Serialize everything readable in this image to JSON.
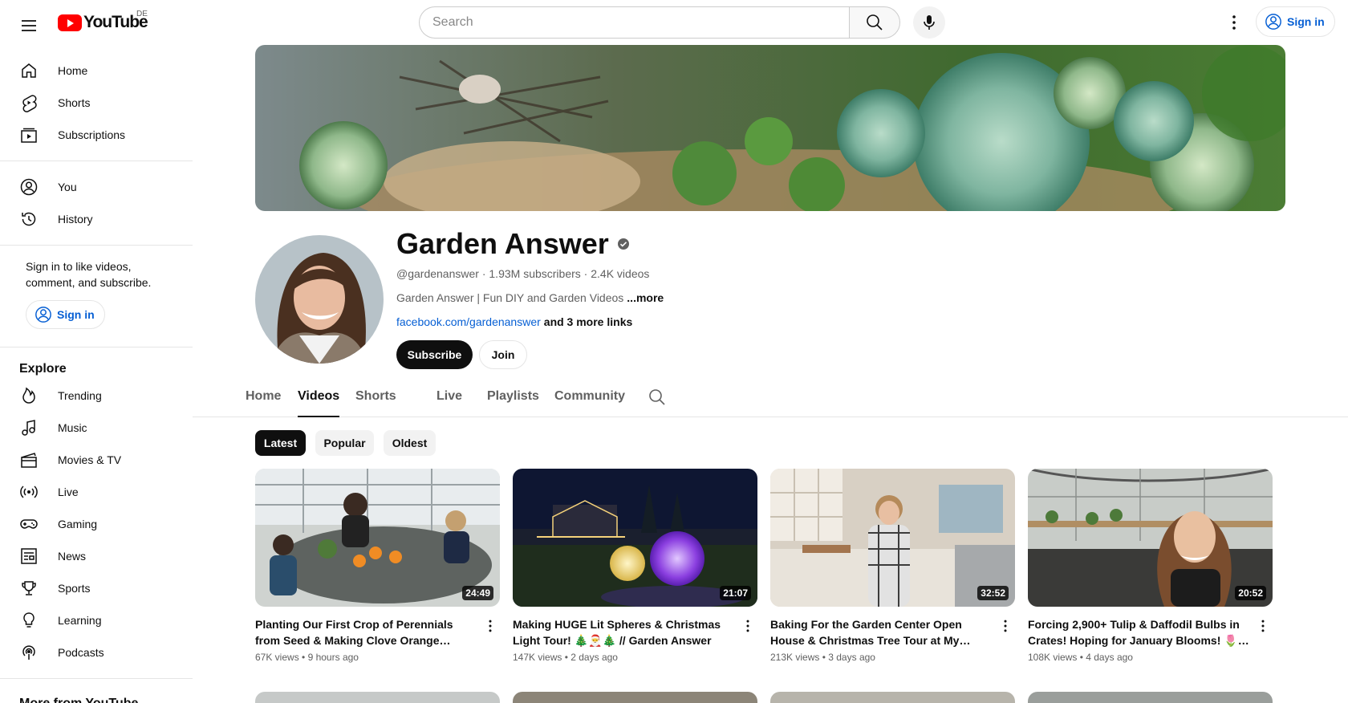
{
  "header": {
    "logo_text": "YouTube",
    "region": "DE",
    "search_placeholder": "Search",
    "signin_label": "Sign in"
  },
  "sidebar": {
    "main_items": [
      {
        "label": "Home",
        "icon": "home-icon"
      },
      {
        "label": "Shorts",
        "icon": "shorts-icon"
      },
      {
        "label": "Subscriptions",
        "icon": "subscriptions-icon"
      }
    ],
    "you_items": [
      {
        "label": "You",
        "icon": "you-icon"
      },
      {
        "label": "History",
        "icon": "history-icon"
      }
    ],
    "signin_prompt": "Sign in to like videos, comment, and subscribe.",
    "signin_label": "Sign in",
    "explore_title": "Explore",
    "explore_items": [
      {
        "label": "Trending",
        "icon": "trending-icon"
      },
      {
        "label": "Music",
        "icon": "music-icon"
      },
      {
        "label": "Movies & TV",
        "icon": "movies-icon"
      },
      {
        "label": "Live",
        "icon": "live-icon"
      },
      {
        "label": "Gaming",
        "icon": "gaming-icon"
      },
      {
        "label": "News",
        "icon": "news-icon"
      },
      {
        "label": "Sports",
        "icon": "sports-icon"
      },
      {
        "label": "Learning",
        "icon": "learning-icon"
      },
      {
        "label": "Podcasts",
        "icon": "podcasts-icon"
      }
    ],
    "more_title": "More from YouTube"
  },
  "channel": {
    "name": "Garden Answer",
    "handle": "@gardenanswer",
    "subscribers": "1.93M subscribers",
    "videos_count": "2.4K videos",
    "description": "Garden Answer | Fun DIY and Garden Videos",
    "more_label": "...more",
    "link": "facebook.com/gardenanswer",
    "more_links": "and 3 more links",
    "subscribe_label": "Subscribe",
    "join_label": "Join"
  },
  "tabs": [
    "Home",
    "Videos",
    "Shorts",
    "Live",
    "Playlists",
    "Community"
  ],
  "active_tab": "Videos",
  "chips": [
    "Latest",
    "Popular",
    "Oldest"
  ],
  "active_chip": "Latest",
  "videos": [
    {
      "title": "Planting Our First Crop of Perennials from Seed & Making Clove Orange Pomanders! 🍊🌱",
      "views": "67K views",
      "age": "9 hours ago",
      "duration": "24:49"
    },
    {
      "title": "Making HUGE Lit Spheres & Christmas Light Tour! 🎄🎅🎄 // Garden Answer",
      "views": "147K views",
      "age": "2 days ago",
      "duration": "21:07"
    },
    {
      "title": "Baking For the Garden Center Open House & Christmas Tree Tour at My Parent's House…",
      "views": "213K views",
      "age": "3 days ago",
      "duration": "32:52"
    },
    {
      "title": "Forcing 2,900+ Tulip & Daffodil Bulbs in Crates! Hoping for January Blooms! 🌷🥰…",
      "views": "108K views",
      "age": "4 days ago",
      "duration": "20:52"
    }
  ]
}
